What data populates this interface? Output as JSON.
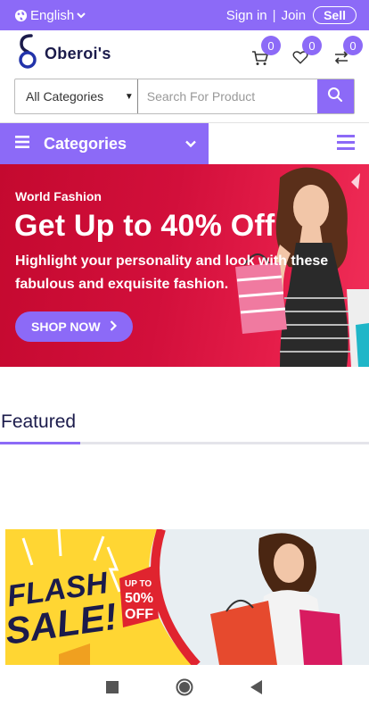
{
  "topbar": {
    "language": "English",
    "sign_in": "Sign in",
    "separator": "|",
    "join": "Join",
    "sell": "Sell"
  },
  "header": {
    "brand": "Oberoi's",
    "cart_count": "0",
    "wishlist_count": "0",
    "compare_count": "0"
  },
  "search": {
    "category_selected": "All Categories",
    "placeholder": "Search For Product"
  },
  "categories_bar": {
    "label": "Categories"
  },
  "hero": {
    "kicker": "World Fashion",
    "headline": "Get Up to 40% Off",
    "subtext": "Highlight your personality and look with these fabulous and exquisite fashion.",
    "cta": "SHOP NOW"
  },
  "featured": {
    "title": "Featured"
  },
  "flash_banner": {
    "line1": "FLASH",
    "line2": "SALE!",
    "tag_top": "UP TO",
    "tag_value": "50%",
    "tag_bottom": "OFF"
  },
  "colors": {
    "accent": "#8c6af7",
    "brand_dark": "#1b1b4b",
    "hero_red": "#d20f3b",
    "flash_yellow": "#ffd633"
  },
  "icons": [
    "globe-icon",
    "chevron-down-icon",
    "cart-icon",
    "heart-icon",
    "compare-icon",
    "search-icon",
    "menu-icon",
    "chevron-right-icon",
    "square-nav-icon",
    "home-nav-icon",
    "back-nav-icon"
  ]
}
